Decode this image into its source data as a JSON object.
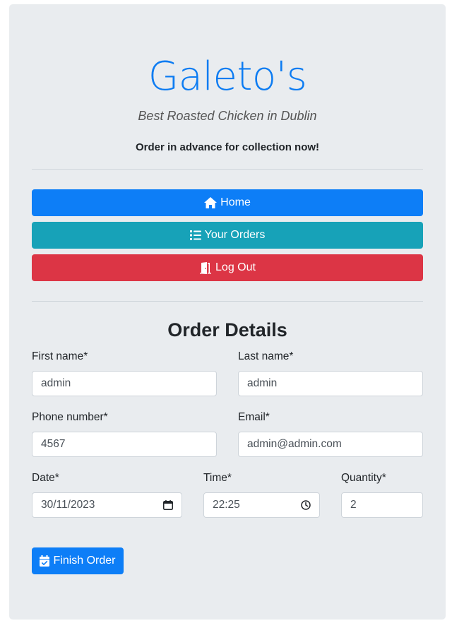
{
  "header": {
    "brand": "Galeto's",
    "tagline": "Best Roasted Chicken in Dublin",
    "lead": "Order in advance for collection now!"
  },
  "nav": {
    "home_label": "Home",
    "orders_label": "Your Orders",
    "logout_label": "Log Out"
  },
  "form": {
    "title": "Order Details",
    "first_name": {
      "label": "First name*",
      "value": "admin"
    },
    "last_name": {
      "label": "Last name*",
      "value": "admin"
    },
    "phone": {
      "label": "Phone number*",
      "value": "4567"
    },
    "email": {
      "label": "Email*",
      "value": "admin@admin.com"
    },
    "date": {
      "label": "Date*",
      "value": "30/11/2023"
    },
    "time": {
      "label": "Time*",
      "value": "22:25"
    },
    "quantity": {
      "label": "Quantity*",
      "value": "2"
    },
    "submit_label": "Finish Order"
  },
  "colors": {
    "primary": "#0d7ef7",
    "info": "#17a2b8",
    "danger": "#dc3545",
    "brand": "#0d7cf2"
  },
  "icons": {
    "home": "home-icon",
    "orders": "list-icon",
    "logout": "door-icon",
    "submit": "calendar-check-icon"
  }
}
